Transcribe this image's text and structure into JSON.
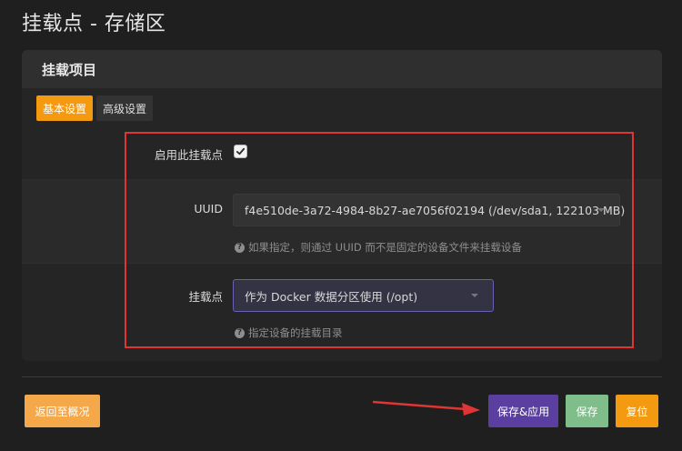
{
  "page": {
    "title": "挂载点 - 存储区"
  },
  "panel": {
    "header": "挂载项目"
  },
  "tabs": [
    {
      "label": "基本设置",
      "active": true
    },
    {
      "label": "高级设置",
      "active": false
    }
  ],
  "form": {
    "enable": {
      "label": "启用此挂载点",
      "checked": true
    },
    "uuid": {
      "label": "UUID",
      "value": "f4e510de-3a72-4984-8b27-ae7056f02194 (/dev/sda1, 122103 MB)",
      "hint": "如果指定，则通过 UUID 而不是固定的设备文件来挂载设备"
    },
    "mount": {
      "label": "挂载点",
      "value": "作为 Docker 数据分区使用 (/opt)",
      "hint": "指定设备的挂载目录"
    }
  },
  "footer": {
    "back_label": "返回至概况",
    "save_apply_label": "保存&应用",
    "save_label": "保存",
    "reset_label": "复位"
  },
  "colors": {
    "accent": "#f49a10",
    "save_apply": "#5a3ea0",
    "save": "#7fbe8a",
    "back": "#f5a84a",
    "annotation_red": "#e03535"
  }
}
